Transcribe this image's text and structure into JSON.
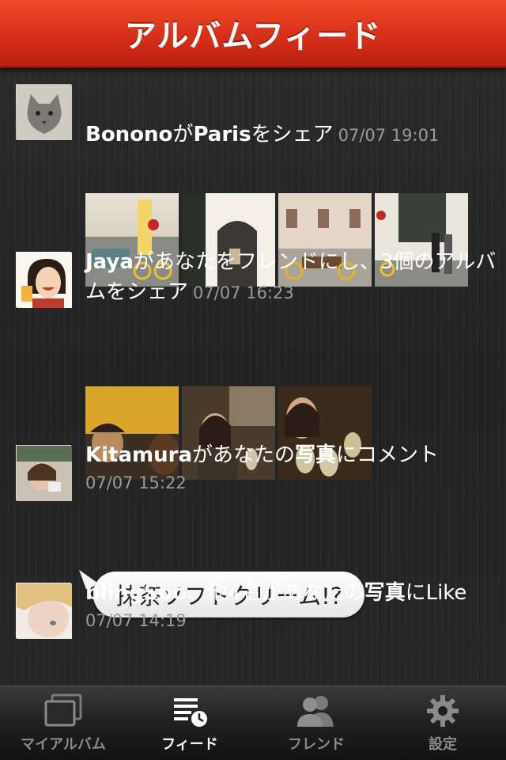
{
  "header": {
    "title": "アルバムフィード"
  },
  "feed": [
    {
      "user": "Bonono",
      "mid": "が",
      "target": "Paris",
      "suffix": "をシェア",
      "time": "07/07 19:01"
    },
    {
      "user": "Jaya",
      "mid": "があなたをフレンドにし、3個のアルバムをシェア",
      "time": "07/07 16:23"
    },
    {
      "user": "Kitamura",
      "mid": "があなたの",
      "target": "写真",
      "suffix": "にコメント",
      "time": "07/07 15:22",
      "comment": "抹茶ソフトクリーム!?"
    },
    {
      "user": "blingSoo",
      "mid": "、他4名があなたの",
      "target": "写真",
      "suffix": "にLike",
      "time": "07/07 14:19"
    }
  ],
  "tabs": [
    {
      "label": "マイアルバム",
      "icon": "photo-album-icon",
      "active": false
    },
    {
      "label": "フィード",
      "icon": "feed-list-icon",
      "active": true
    },
    {
      "label": "フレンド",
      "icon": "friends-icon",
      "active": false
    },
    {
      "label": "設定",
      "icon": "gear-icon",
      "active": false
    }
  ],
  "colors": {
    "header": "#d7301a",
    "time": "#9a9a9a",
    "tab_active": "#ffffff",
    "tab_inactive": "#8a8a8a"
  }
}
